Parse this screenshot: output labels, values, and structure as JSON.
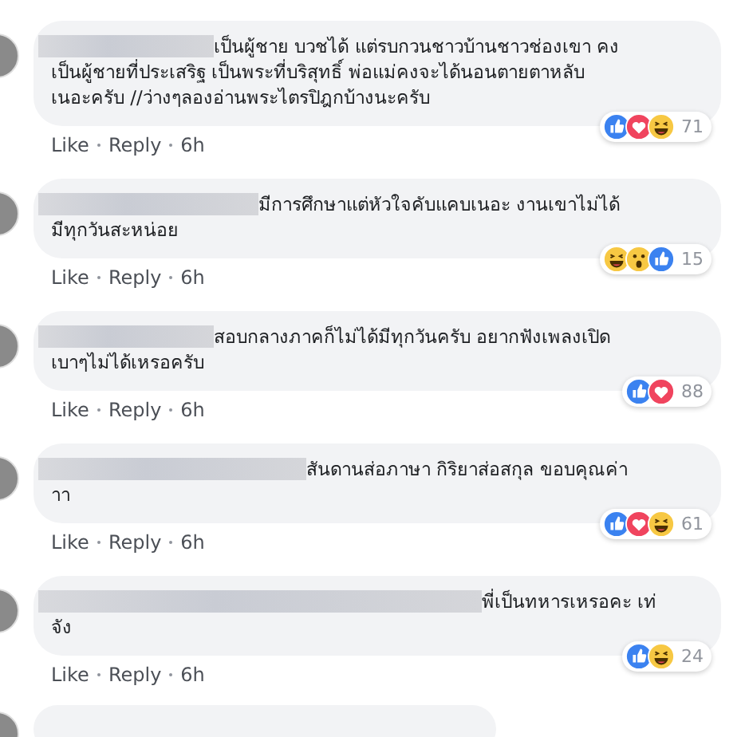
{
  "comments": [
    {
      "lines": [
        "เป็นผู้ชาย บวชได้ แต่รบกวนชาวบ้านชาวช่องเขา คง",
        "เป็นผู้ชายที่ประเสริฐ เป็นพระที่บริสุทธิ์ พ่อแม่คงจะได้นอนตายตาหลับ",
        "เนอะครับ //ว่างๆลองอ่านพระไตรปิฎกบ้างนะครับ"
      ],
      "reactions": [
        {
          "kind": "like"
        },
        {
          "kind": "love"
        },
        {
          "kind": "haha"
        }
      ],
      "count": "71",
      "actions": [
        "Like",
        "Reply",
        "6h"
      ]
    },
    {
      "lines": [
        "มีการศึกษาแต่หัวใจคับแคบเนอะ งานเขาไม่ได้",
        "มีทุกวันสะหน่อย"
      ],
      "reactions": [
        {
          "kind": "haha"
        },
        {
          "kind": "wow"
        },
        {
          "kind": "like"
        }
      ],
      "count": "15",
      "actions": [
        "Like",
        "Reply",
        "6h"
      ]
    },
    {
      "lines": [
        "สอบกลางภาคก็ไม่ได้มีทุกวันครับ อยากฟังเพลงเปิด",
        "เบาๆไม่ได้เหรอครับ"
      ],
      "reactions": [
        {
          "kind": "like"
        },
        {
          "kind": "love"
        }
      ],
      "count": "88",
      "actions": [
        "Like",
        "Reply",
        "6h"
      ]
    },
    {
      "lines": [
        "สันดานส่อภาษา กิริยาส่อสกุล ขอบคุณค่า",
        "าา"
      ],
      "reactions": [
        {
          "kind": "like"
        },
        {
          "kind": "love"
        },
        {
          "kind": "haha"
        }
      ],
      "count": "61",
      "actions": [
        "Like",
        "Reply",
        "6h"
      ]
    },
    {
      "lines": [
        "พี่เป็นทหารเหรอคะ เท่",
        "จัง"
      ],
      "reactions": [
        {
          "kind": "like"
        },
        {
          "kind": "haha"
        }
      ],
      "count": "24",
      "actions": [
        "Like",
        "Reply",
        "6h"
      ]
    }
  ]
}
